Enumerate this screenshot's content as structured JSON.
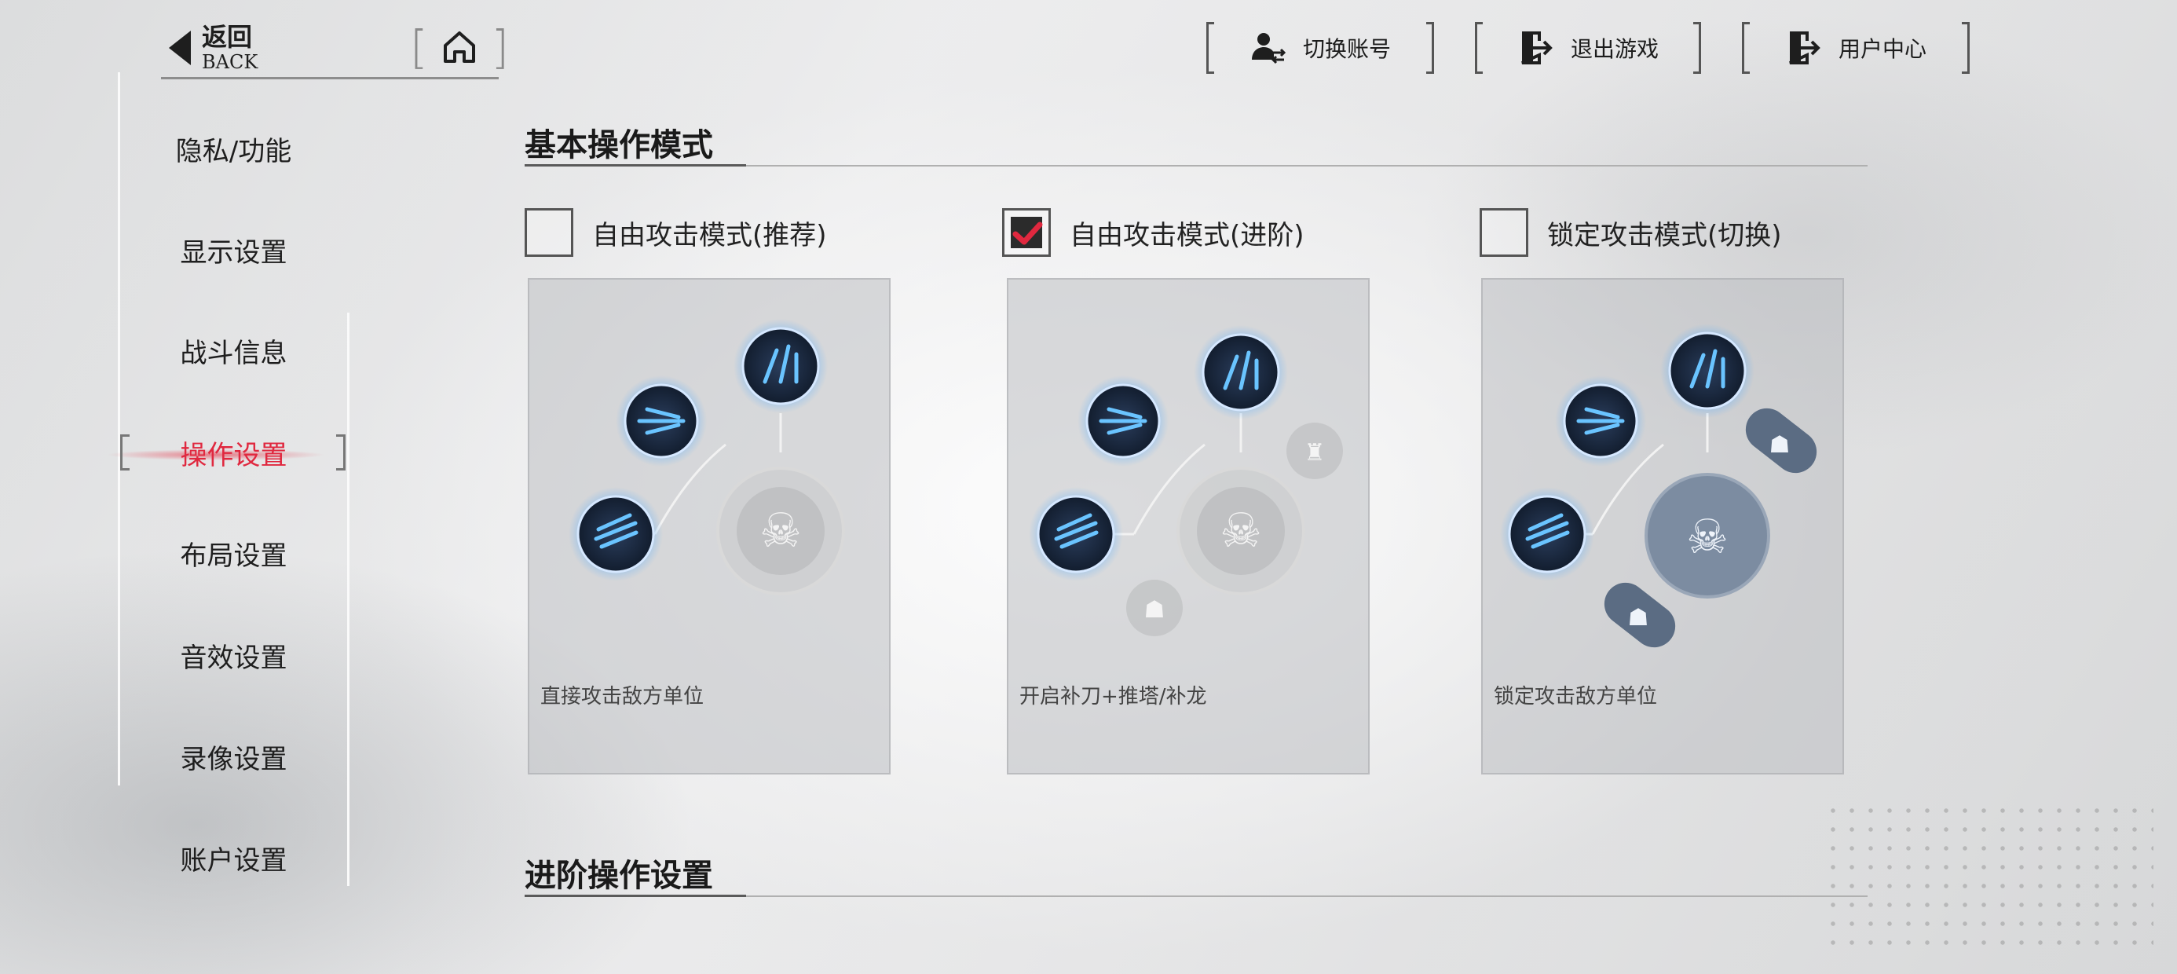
{
  "header": {
    "back_cn": "返回",
    "back_en": "BACK",
    "home_icon": "home-icon",
    "buttons": [
      {
        "label": "切换账号",
        "icon": "switch-account-icon"
      },
      {
        "label": "退出游戏",
        "icon": "exit-icon"
      },
      {
        "label": "用户中心",
        "icon": "user-center-icon"
      }
    ]
  },
  "sidebar": {
    "items": [
      {
        "label": "隐私/功能",
        "active": false
      },
      {
        "label": "显示设置",
        "active": false
      },
      {
        "label": "战斗信息",
        "active": false
      },
      {
        "label": "操作设置",
        "active": true
      },
      {
        "label": "布局设置",
        "active": false
      },
      {
        "label": "音效设置",
        "active": false
      },
      {
        "label": "录像设置",
        "active": false
      },
      {
        "label": "账户设置",
        "active": false
      }
    ]
  },
  "main": {
    "section1_title": "基本操作模式",
    "modes": [
      {
        "label": "自由攻击模式(推荐)",
        "checked": false,
        "description": "直接攻击敌方单位",
        "extras": "none"
      },
      {
        "label": "自由攻击模式(进阶)",
        "checked": true,
        "description": "开启补刀+推塔/补龙",
        "extras": "tower-and-minion"
      },
      {
        "label": "锁定攻击模式(切换)",
        "checked": false,
        "description": "锁定攻击敌方单位",
        "extras": "lock-targets"
      }
    ],
    "section2_title": "进阶操作设置"
  },
  "colors": {
    "accent_red": "#e0283f",
    "skill_blue": "#3ab0ff",
    "skill_dark": "#1b2a3f"
  }
}
